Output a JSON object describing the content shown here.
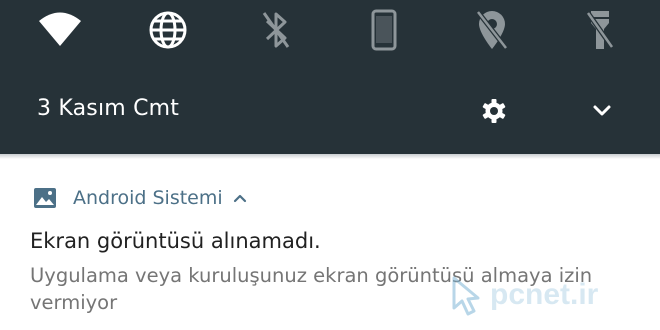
{
  "quick_settings": {
    "tiles": [
      {
        "icon": "wifi-icon",
        "state": "on"
      },
      {
        "icon": "globe-icon",
        "state": "on"
      },
      {
        "icon": "bluetooth-icon",
        "state": "off"
      },
      {
        "icon": "phone-rotate-icon",
        "state": "off"
      },
      {
        "icon": "location-off-icon",
        "state": "off"
      },
      {
        "icon": "flashlight-off-icon",
        "state": "off"
      }
    ],
    "date": "3 Kasım Cmt",
    "settings_icon": "gear-icon",
    "expand_icon": "chevron-down-icon",
    "colors": {
      "shade_bg": "#263238",
      "on": "#ffffff",
      "off": "#8e969a"
    }
  },
  "notification": {
    "app_icon": "screenshot-image-icon",
    "app_name": "Android Sistemi",
    "title": "Ekran görüntüsü alınamadı.",
    "text": "Uygulama veya kuruluşunuz ekran görüntüsü almaya izin vermiyor",
    "colors": {
      "app_accent": "#4c7087",
      "title": "#212121",
      "text": "#757575"
    }
  },
  "watermark": {
    "text": "pcnet.ir"
  }
}
